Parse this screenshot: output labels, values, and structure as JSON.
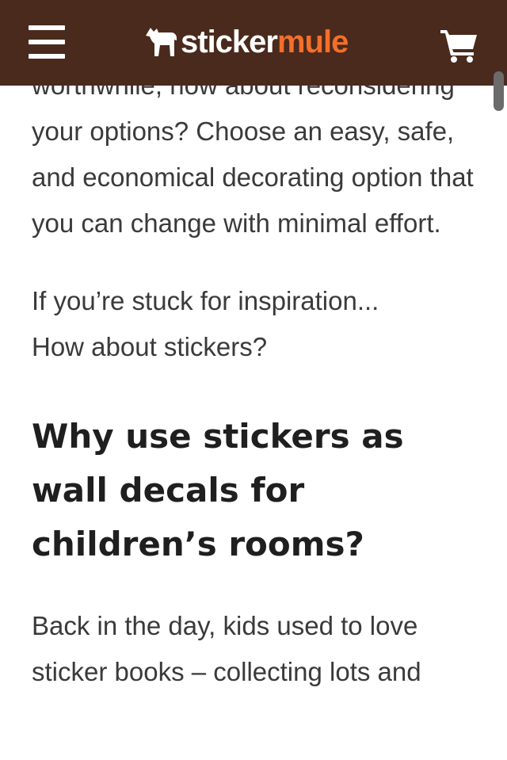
{
  "header": {
    "logo_text_white": "sticker",
    "logo_text_orange": "mule",
    "menu_icon": "hamburger-menu-icon",
    "cart_icon": "shopping-cart-icon",
    "colors": {
      "background": "#4a2a1c",
      "logo_white": "#ffffff",
      "logo_orange": "#f36f2a"
    }
  },
  "article": {
    "partial_line": "worthwhile, how about",
    "paragraph_1": "reconsidering your options? Choose an easy, safe, and economical decorating option that you can change with minimal effort.",
    "paragraph_2_line_1": "If you’re stuck for inspiration...",
    "paragraph_2_line_2": "How about stickers?",
    "heading": "Why use stickers as wall decals for children’s rooms?",
    "paragraph_3": "Back in the day, kids used to love sticker books – collecting lots and"
  }
}
